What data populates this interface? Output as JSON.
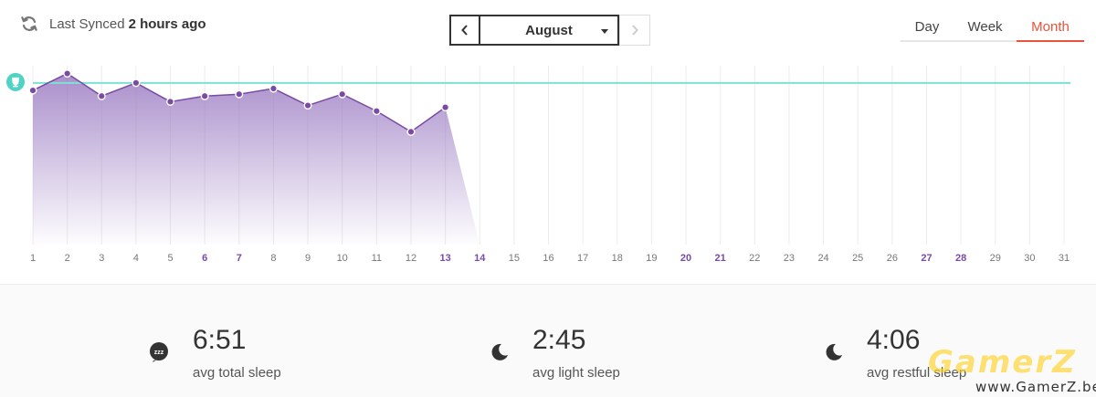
{
  "sync": {
    "label": "Last Synced",
    "time": "2 hours ago"
  },
  "month_nav": {
    "selected": "August"
  },
  "range_tabs": [
    {
      "label": "Day",
      "active": false
    },
    {
      "label": "Week",
      "active": false
    },
    {
      "label": "Month",
      "active": true
    }
  ],
  "chart_data": {
    "type": "area",
    "x": [
      1,
      2,
      3,
      4,
      5,
      6,
      7,
      8,
      9,
      10,
      11,
      12,
      13,
      14,
      15,
      16,
      17,
      18,
      19,
      20,
      21,
      22,
      23,
      24,
      25,
      26,
      27,
      28,
      29,
      30,
      31
    ],
    "highlighted_days": [
      6,
      7,
      13,
      14,
      20,
      21,
      27,
      28
    ],
    "series": [
      {
        "values": [
          8.2,
          9.1,
          7.9,
          8.6,
          7.6,
          7.9,
          8.0,
          8.3,
          7.4,
          8.0,
          7.1,
          6.0,
          7.3
        ]
      }
    ],
    "goal": 8.6,
    "goal_icon": "trophy-icon",
    "ylim": [
      0,
      10
    ],
    "colors": {
      "area": "#a788c9",
      "line": "#7a4aa5",
      "point": "#7a4aa5",
      "goal": "#7fe0d4",
      "highlight": "#7a4aa5",
      "tick": "#777777"
    }
  },
  "stats": [
    {
      "icon": "zzz-icon",
      "value": "6:51",
      "caption": "avg total sleep"
    },
    {
      "icon": "moon-icon",
      "value": "2:45",
      "caption": "avg light sleep"
    },
    {
      "icon": "moon-icon",
      "value": "4:06",
      "caption": "avg restful sleep"
    }
  ],
  "watermark": {
    "text": "GamerZ",
    "url": "www.GamerZ.be"
  }
}
